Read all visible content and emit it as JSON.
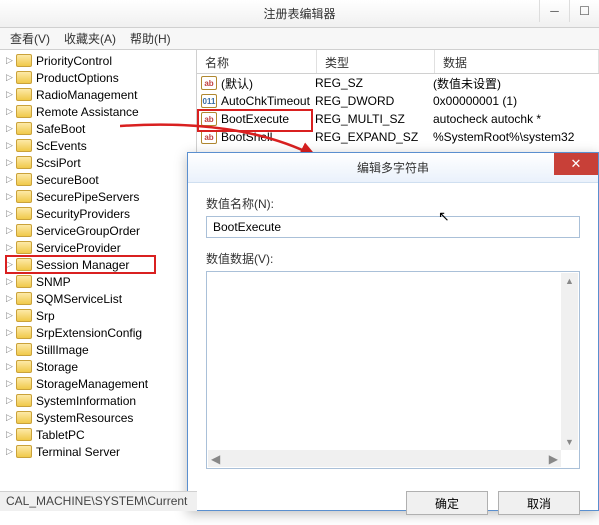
{
  "window": {
    "title": "注册表编辑器",
    "menu": {
      "view": "查看(V)",
      "favorites": "收藏夹(A)",
      "help": "帮助(H)"
    }
  },
  "tree": [
    "PriorityControl",
    "ProductOptions",
    "RadioManagement",
    "Remote Assistance",
    "SafeBoot",
    "ScEvents",
    "ScsiPort",
    "SecureBoot",
    "SecurePipeServers",
    "SecurityProviders",
    "ServiceGroupOrder",
    "ServiceProvider",
    "Session Manager",
    "SNMP",
    "SQMServiceList",
    "Srp",
    "SrpExtensionConfig",
    "StillImage",
    "Storage",
    "StorageManagement",
    "SystemInformation",
    "SystemResources",
    "TabletPC",
    "Terminal Server"
  ],
  "tree_highlight": "Session Manager",
  "list": {
    "headers": {
      "name": "名称",
      "type": "类型",
      "data": "数据"
    },
    "rows": [
      {
        "icon": "ab",
        "name": "(默认)",
        "type": "REG_SZ",
        "data": "(数值未设置)"
      },
      {
        "icon": "bin",
        "name": "AutoChkTimeout",
        "type": "REG_DWORD",
        "data": "0x00000001 (1)"
      },
      {
        "icon": "ab",
        "name": "BootExecute",
        "type": "REG_MULTI_SZ",
        "data": "autocheck autochk *",
        "highlight": true
      },
      {
        "icon": "ab",
        "name": "BootShell",
        "type": "REG_EXPAND_SZ",
        "data": "%SystemRoot%\\system32"
      }
    ]
  },
  "dialog": {
    "title": "编辑多字符串",
    "name_label": "数值名称(N):",
    "name_value": "BootExecute",
    "data_label": "数值数据(V):",
    "data_value": "",
    "ok": "确定",
    "cancel": "取消"
  },
  "statusbar": "CAL_MACHINE\\SYSTEM\\Current"
}
